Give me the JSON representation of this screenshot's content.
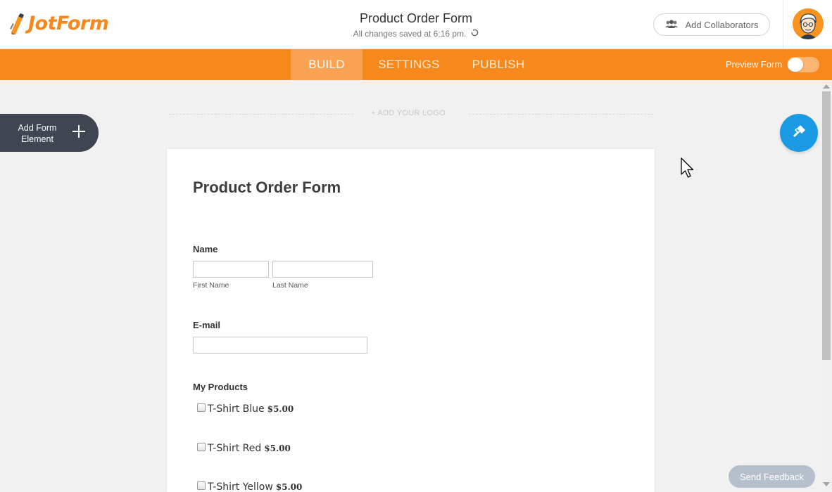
{
  "header": {
    "brand": "JotForm",
    "form_title": "Product Order Form",
    "save_status": "All changes saved at 6:16 pm.",
    "collaborators_label": "Add Collaborators"
  },
  "nav": {
    "tabs": [
      {
        "label": "BUILD",
        "active": true
      },
      {
        "label": "SETTINGS",
        "active": false
      },
      {
        "label": "PUBLISH",
        "active": false
      }
    ],
    "preview_label": "Preview Form",
    "preview_on": false
  },
  "builder": {
    "add_element_label": "Add Form Element",
    "add_logo_label": "+ ADD YOUR LOGO"
  },
  "form": {
    "title": "Product Order Form",
    "name": {
      "label": "Name",
      "first_label": "First Name",
      "last_label": "Last Name",
      "first_value": "",
      "last_value": ""
    },
    "email": {
      "label": "E-mail",
      "value": ""
    },
    "products": {
      "label": "My Products",
      "items": [
        {
          "name": "T-Shirt Blue",
          "price": "$5.00",
          "checked": false
        },
        {
          "name": "T-Shirt Red",
          "price": "$5.00",
          "checked": false
        },
        {
          "name": "T-Shirt Yellow",
          "price": "$5.00",
          "checked": false
        }
      ]
    }
  },
  "feedback_label": "Send Feedback",
  "colors": {
    "brand_orange": "#f7881c",
    "accent_blue": "#1a9ae2",
    "dark_panel": "#3f4652"
  }
}
